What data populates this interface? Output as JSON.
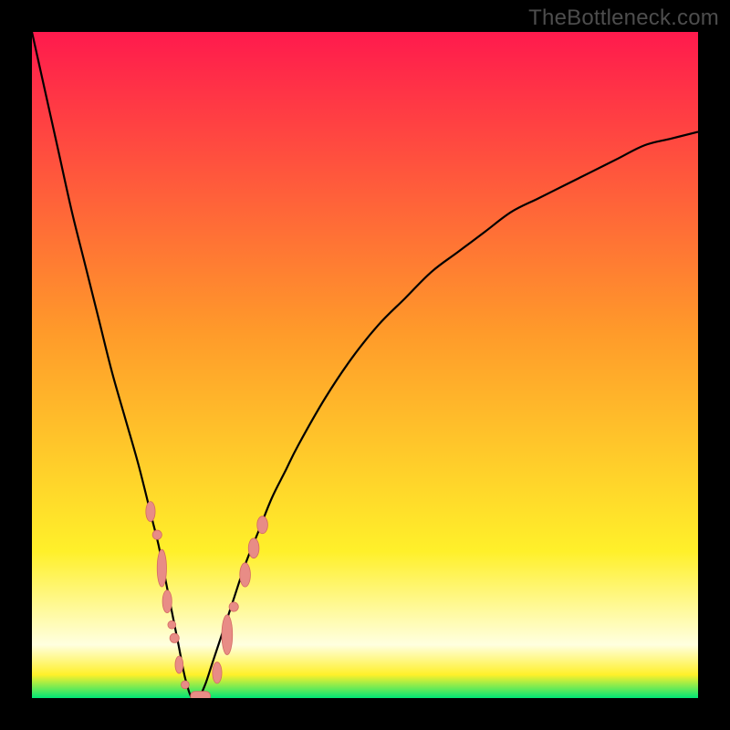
{
  "watermark": "TheBottleneck.com",
  "colors": {
    "frame": "#000000",
    "grad_top": "#ff1a4d",
    "grad_orange": "#ff9a2a",
    "grad_yellow": "#fff02a",
    "grad_haze": "#ffffe0",
    "grad_green": "#00e676",
    "curve": "#000000",
    "marker_fill": "#e88c86",
    "marker_stroke": "#d46a63"
  },
  "chart_data": {
    "type": "line",
    "title": "",
    "xlabel": "",
    "ylabel": "",
    "xlim": [
      0,
      100
    ],
    "ylim": [
      0,
      100
    ],
    "legend": null,
    "series": [
      {
        "name": "bottleneck-curve",
        "x": [
          0,
          2,
          4,
          6,
          8,
          10,
          12,
          14,
          16,
          18,
          19,
          20,
          21,
          22,
          23,
          24,
          25,
          26,
          27,
          28,
          30,
          32,
          34,
          36,
          38,
          40,
          44,
          48,
          52,
          56,
          60,
          64,
          68,
          72,
          76,
          80,
          84,
          88,
          92,
          96,
          100
        ],
        "y": [
          100,
          91,
          82,
          73,
          65,
          57,
          49,
          42,
          35,
          27,
          23,
          18,
          13,
          8,
          3,
          0,
          0,
          2,
          5,
          8,
          14,
          20,
          25,
          30,
          34,
          38,
          45,
          51,
          56,
          60,
          64,
          67,
          70,
          73,
          75,
          77,
          79,
          81,
          83,
          84,
          85
        ]
      }
    ],
    "markers": [
      {
        "x": 17.8,
        "y": 28.0,
        "shape": "ellipse",
        "rx": 0.7,
        "ry": 1.5
      },
      {
        "x": 18.8,
        "y": 24.5,
        "shape": "circle",
        "r": 0.7
      },
      {
        "x": 19.5,
        "y": 19.5,
        "shape": "ellipse",
        "rx": 0.7,
        "ry": 2.8
      },
      {
        "x": 20.3,
        "y": 14.5,
        "shape": "ellipse",
        "rx": 0.7,
        "ry": 1.7
      },
      {
        "x": 21.0,
        "y": 11.0,
        "shape": "circle",
        "r": 0.6
      },
      {
        "x": 21.4,
        "y": 9.0,
        "shape": "circle",
        "r": 0.7
      },
      {
        "x": 22.1,
        "y": 5.0,
        "shape": "ellipse",
        "rx": 0.6,
        "ry": 1.3
      },
      {
        "x": 23.0,
        "y": 2.0,
        "shape": "circle",
        "r": 0.6
      },
      {
        "x": 25.3,
        "y": 0.3,
        "shape": "capsule",
        "w": 3.0,
        "h": 1.4
      },
      {
        "x": 27.8,
        "y": 3.8,
        "shape": "ellipse",
        "rx": 0.7,
        "ry": 1.6
      },
      {
        "x": 29.3,
        "y": 9.5,
        "shape": "ellipse",
        "rx": 0.8,
        "ry": 3.0
      },
      {
        "x": 30.3,
        "y": 13.7,
        "shape": "circle",
        "r": 0.7
      },
      {
        "x": 32.0,
        "y": 18.5,
        "shape": "ellipse",
        "rx": 0.8,
        "ry": 1.8
      },
      {
        "x": 33.3,
        "y": 22.5,
        "shape": "ellipse",
        "rx": 0.8,
        "ry": 1.5
      },
      {
        "x": 34.6,
        "y": 26.0,
        "shape": "ellipse",
        "rx": 0.8,
        "ry": 1.3
      }
    ],
    "gradient_stops": [
      {
        "offset": 0.0,
        "y": 100,
        "color_key": "grad_top"
      },
      {
        "offset": 0.45,
        "y": 55,
        "color_key": "grad_orange"
      },
      {
        "offset": 0.78,
        "y": 22,
        "color_key": "grad_yellow"
      },
      {
        "offset": 0.92,
        "y": 8,
        "color_key": "grad_haze"
      },
      {
        "offset": 0.965,
        "y": 3.5,
        "color_key": "grad_yellow"
      },
      {
        "offset": 1.0,
        "y": 0,
        "color_key": "grad_green"
      }
    ]
  }
}
